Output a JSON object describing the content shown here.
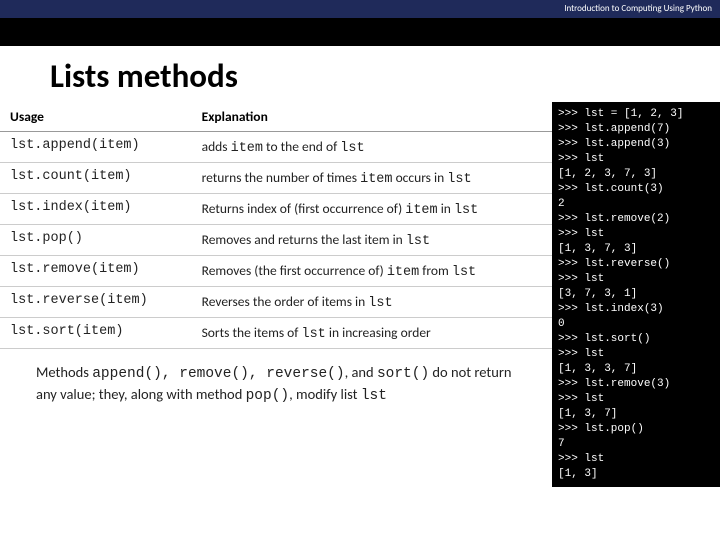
{
  "header": {
    "booktitle": "Introduction to Computing Using Python"
  },
  "page_title": "Lists methods",
  "table": {
    "head_usage": "Usage",
    "head_expl": "Explanation",
    "rows": [
      {
        "usage": "lst.append(item)",
        "a": "adds ",
        "b": "item",
        "c": " to the end of ",
        "d": "lst",
        "e": ""
      },
      {
        "usage": "lst.count(item)",
        "a": "returns the number of times ",
        "b": "item",
        "c": " occurs in ",
        "d": "lst",
        "e": ""
      },
      {
        "usage": "lst.index(item)",
        "a": "Returns index of (first occurrence of) ",
        "b": "item",
        "c": " in ",
        "d": "lst",
        "e": ""
      },
      {
        "usage": "lst.pop()",
        "a": "Removes and returns the last item in ",
        "b": "lst",
        "c": "",
        "d": "",
        "e": ""
      },
      {
        "usage": "lst.remove(item)",
        "a": "Removes (the first occurrence of) ",
        "b": "item",
        "c": " from ",
        "d": "lst",
        "e": ""
      },
      {
        "usage": "lst.reverse(item)",
        "a": "Reverses the order of items in ",
        "b": "lst",
        "c": "",
        "d": "",
        "e": ""
      },
      {
        "usage": "lst.sort(item)",
        "a": "Sorts the items of ",
        "b": "lst",
        "c": " in increasing order",
        "d": "",
        "e": ""
      }
    ]
  },
  "note": {
    "t0": "Methods ",
    "m0": "append(), remove(), reverse()",
    "t1": ", and ",
    "m1": "sort()",
    "t2": " do not return any value; they, along with method ",
    "m2": "pop()",
    "t3": ", modify list ",
    "m3": "lst"
  },
  "repl": ">>> lst = [1, 2, 3]\n>>> lst.append(7)\n>>> lst.append(3)\n>>> lst\n[1, 2, 3, 7, 3]\n>>> lst.count(3)\n2\n>>> lst.remove(2)\n>>> lst\n[1, 3, 7, 3]\n>>> lst.reverse()\n>>> lst\n[3, 7, 3, 1]\n>>> lst.index(3)\n0\n>>> lst.sort()\n>>> lst\n[1, 3, 3, 7]\n>>> lst.remove(3)\n>>> lst\n[1, 3, 7]\n>>> lst.pop()\n7\n>>> lst\n[1, 3]"
}
